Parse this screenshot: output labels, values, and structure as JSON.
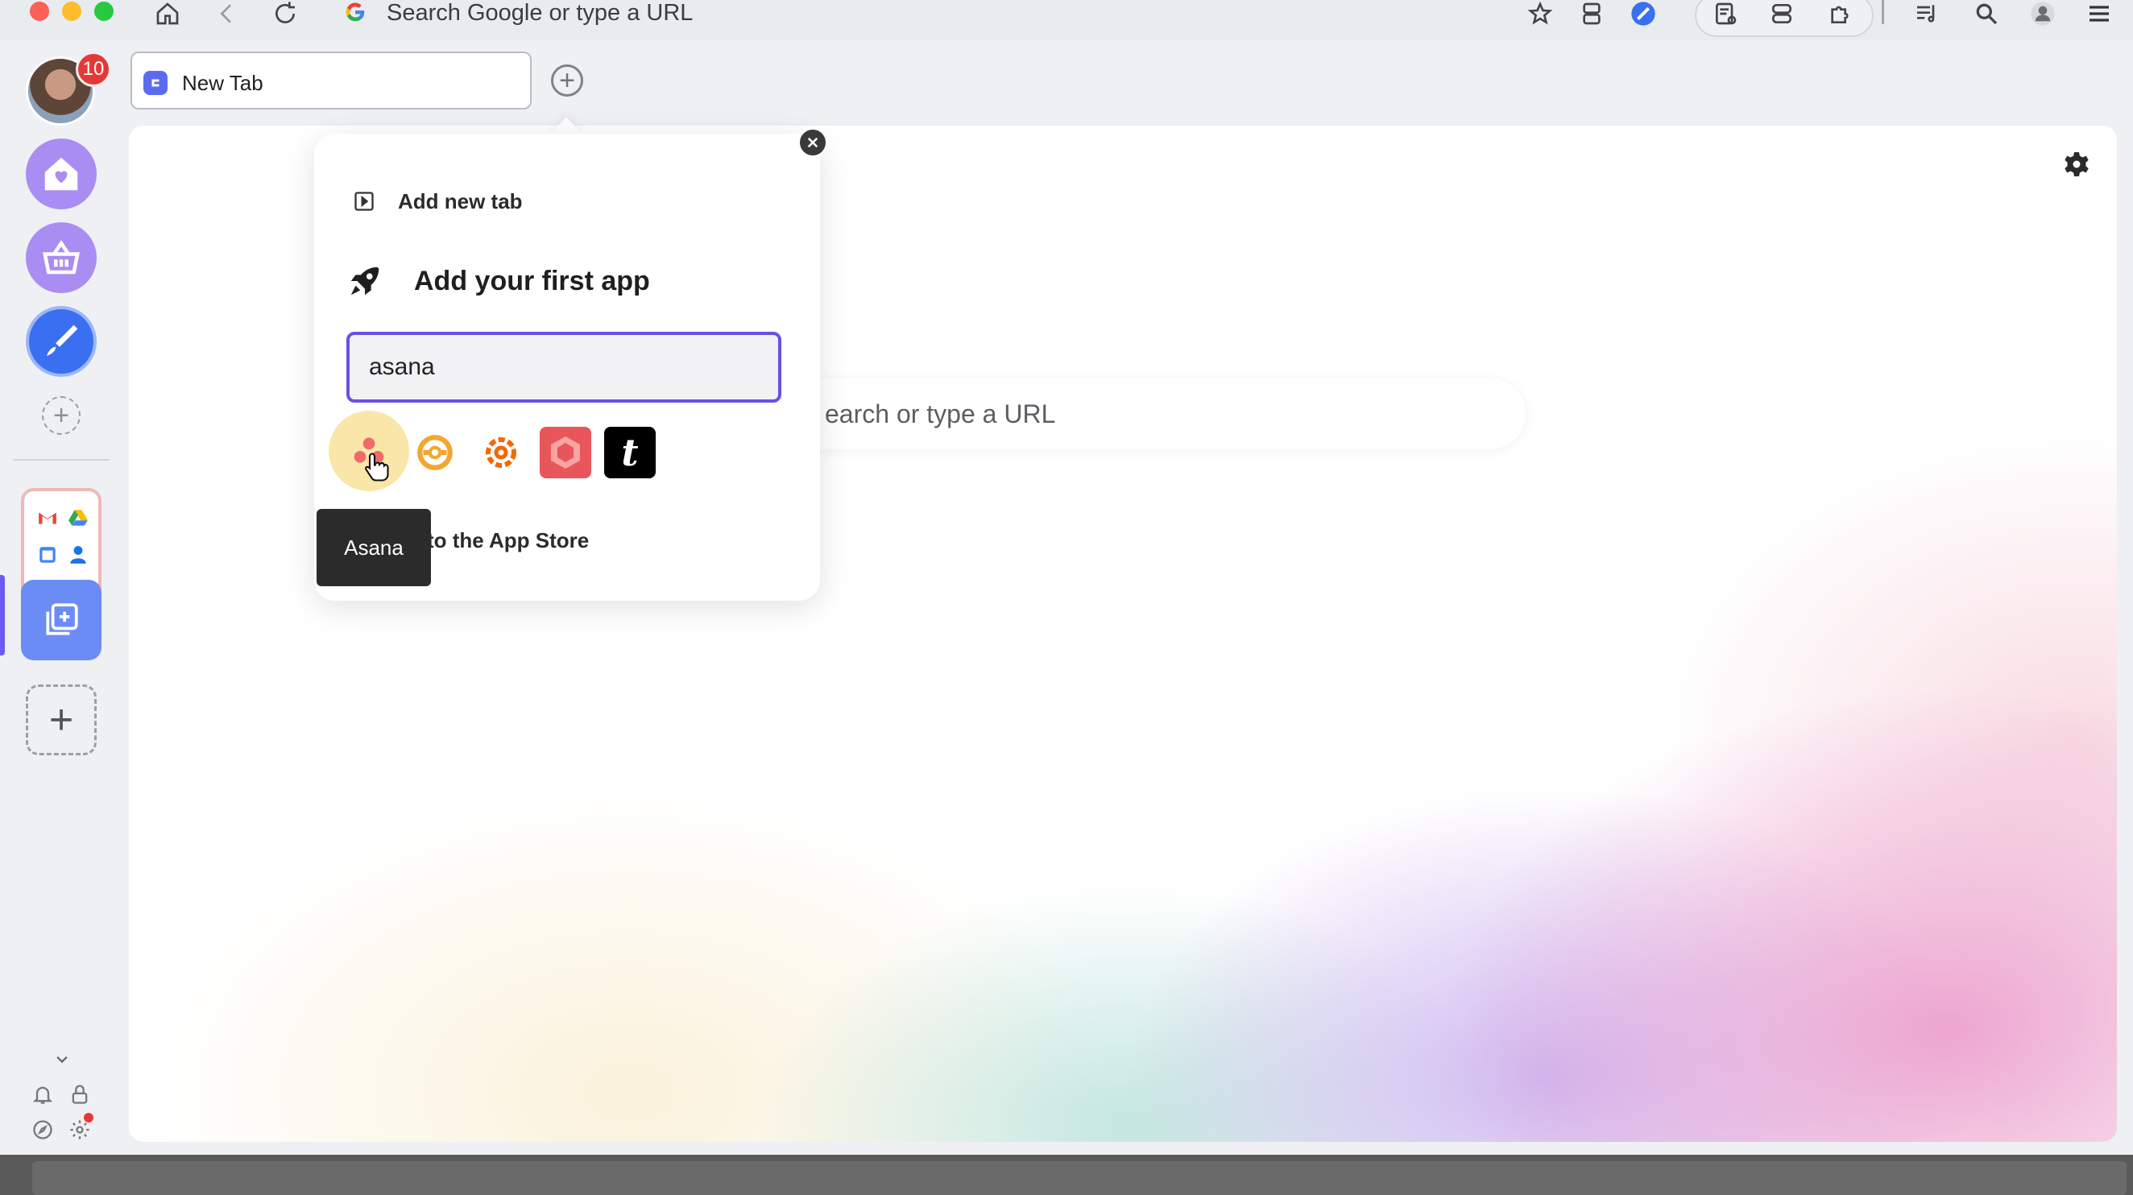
{
  "browser": {
    "omnibox_text": "Search Google or type a URL",
    "icons": [
      "home-icon",
      "back-icon",
      "reload-icon",
      "star-icon",
      "sidebar-icon",
      "paint-brush-icon",
      "reading-list-icon",
      "tab-search-icon",
      "extensions-icon",
      "media-icon",
      "search-icon",
      "profile-icon",
      "menu-icon"
    ]
  },
  "sidebar": {
    "notification_count": "10",
    "apps": [
      "home-heart-app",
      "basket-app",
      "brush-app"
    ],
    "group_icons": [
      "gmail",
      "drive",
      "calendar",
      "contacts"
    ]
  },
  "tabs": {
    "active_tab_label": "New Tab"
  },
  "content": {
    "search_placeholder": "earch or type a URL"
  },
  "popup": {
    "add_new_tab_label": "Add new tab",
    "heading": "Add your first app",
    "search_value": "asana",
    "results": [
      "Asana",
      "app-2",
      "Grafana",
      "app-4",
      "app-5"
    ],
    "store_text": "to the App Store",
    "tooltip": "Asana"
  },
  "colors": {
    "accent": "#6b50e3",
    "badge": "#e53935",
    "sidebar_active": "#6c8cf5"
  }
}
